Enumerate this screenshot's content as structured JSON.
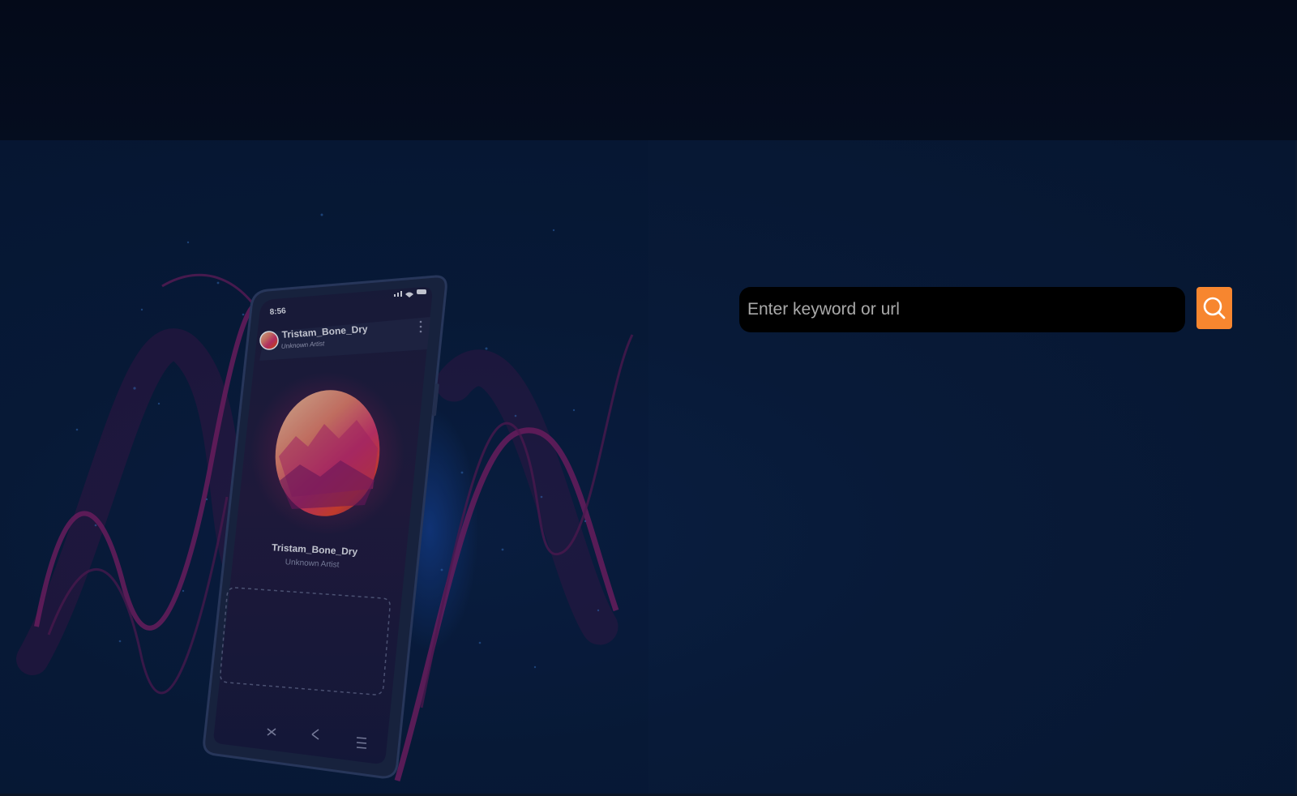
{
  "search": {
    "placeholder": "Enter keyword or url",
    "value": "",
    "button_icon": "search-icon",
    "button_color": "#f7862f"
  },
  "phone": {
    "status_time": "8:56",
    "header_track_title": "Tristam_Bone_Dry",
    "header_track_artist": "Unknown Artist",
    "track_title": "Tristam_Bone_Dry",
    "track_artist": "Unknown Artist",
    "controls": [
      "shuffle-icon",
      "share-icon",
      "playlist-icon"
    ]
  },
  "colors": {
    "background": "#061630",
    "top_bar": "#040a19",
    "wave": "#8a1f6e",
    "accent": "#f7862f"
  }
}
